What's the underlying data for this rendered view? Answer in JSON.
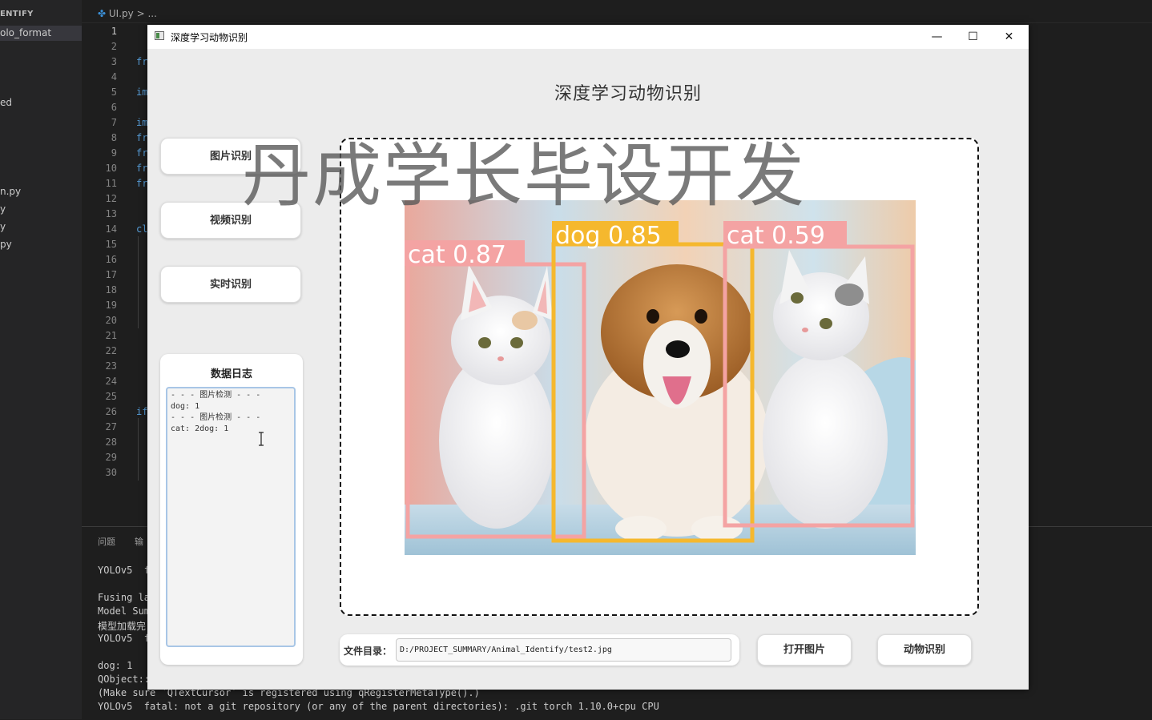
{
  "vscode": {
    "explorer_title": "ENTIFY",
    "explorer_items": [
      "olo_format",
      "ed",
      "n.py",
      "y",
      "y",
      "py"
    ],
    "breadcrumb_file": "UI.py",
    "breadcrumb_sep": ">",
    "breadcrumb_more": "...",
    "line_numbers": [
      "1",
      "2",
      "3",
      "4",
      "5",
      "6",
      "7",
      "8",
      "9",
      "10",
      "11",
      "12",
      "13",
      "14",
      "15",
      "16",
      "17",
      "18",
      "19",
      "20",
      "21",
      "22",
      "23",
      "24",
      "25",
      "26",
      "27",
      "28",
      "29",
      "30"
    ],
    "code_fragments": [
      "fr",
      "im",
      "im",
      "fr",
      "fr",
      "fr",
      "fr",
      "cl",
      "if"
    ],
    "panel_tabs": [
      "问题",
      "输"
    ],
    "terminal_lines": [
      "YOLOv5  f",
      "Fusing la",
      "Model Sum",
      "模型加载完",
      "YOLOv5  f",
      "dog: 1",
      "QObject::",
      "(Make sure `QTextCursor` is registered using qRegisterMetaType().)",
      "YOLOv5  fatal: not a git repository (or any of the parent directories): .git torch 1.10.0+cpu CPU"
    ]
  },
  "window": {
    "title": "深度学习动物识别",
    "minimize": "—",
    "maximize": "☐",
    "close": "✕"
  },
  "app": {
    "heading": "深度学习动物识别",
    "buttons": {
      "image_detect": "图片识别",
      "video_detect": "视频识别",
      "realtime_detect": "实时识别",
      "open_image": "打开图片",
      "animal_detect": "动物识别"
    },
    "log": {
      "title": "数据日志",
      "lines": [
        "- - - 图片检测 - - -",
        "dog: 1",
        "- - - 图片检测 - - -",
        "cat: 2dog: 1"
      ]
    },
    "file_path": {
      "label": "文件目录：",
      "value": "D:/PROJECT_SUMMARY/Animal_Identify/test2.jpg"
    },
    "watermark": "丹成学长毕设开发",
    "detections": [
      {
        "label": "cat 0.87",
        "color": "#f4a3a3"
      },
      {
        "label": "dog 0.85",
        "color": "#f5b82e"
      },
      {
        "label": "cat 0.59",
        "color": "#f4a3a3"
      }
    ]
  }
}
